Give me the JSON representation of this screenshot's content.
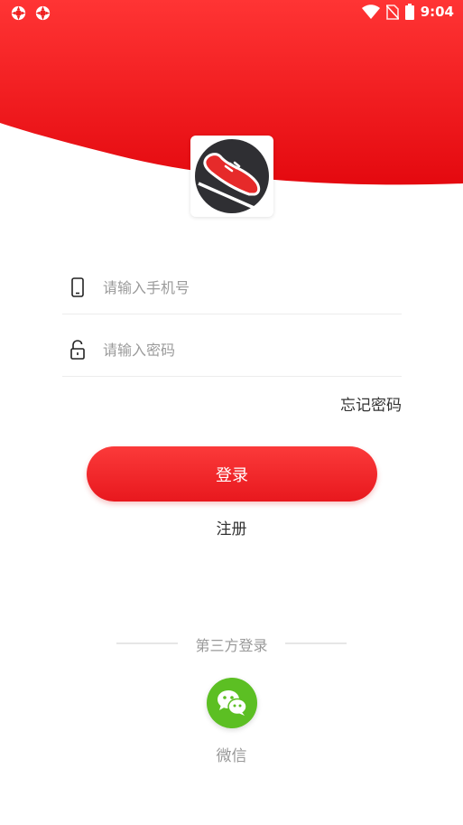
{
  "status_bar": {
    "time": "9:04",
    "notification_icons": [
      "app-notification-icon",
      "app-notification-icon"
    ],
    "system_icons": [
      "wifi-icon",
      "no-sim-icon",
      "battery-icon"
    ]
  },
  "colors": {
    "brand_red": "#e8181e",
    "wechat_green": "#5cbf23",
    "logo_dark": "#2f2f33"
  },
  "logo": {
    "icon": "sneaker-logo-icon"
  },
  "form": {
    "phone": {
      "placeholder": "请输入手机号",
      "value": "",
      "icon": "phone-icon"
    },
    "password": {
      "placeholder": "请输入密码",
      "value": "",
      "icon": "unlock-icon"
    },
    "forgot_label": "忘记密码"
  },
  "actions": {
    "login_label": "登录",
    "register_label": "注册"
  },
  "third_party": {
    "title": "第三方登录",
    "wechat_label": "微信",
    "wechat_icon": "wechat-icon"
  }
}
